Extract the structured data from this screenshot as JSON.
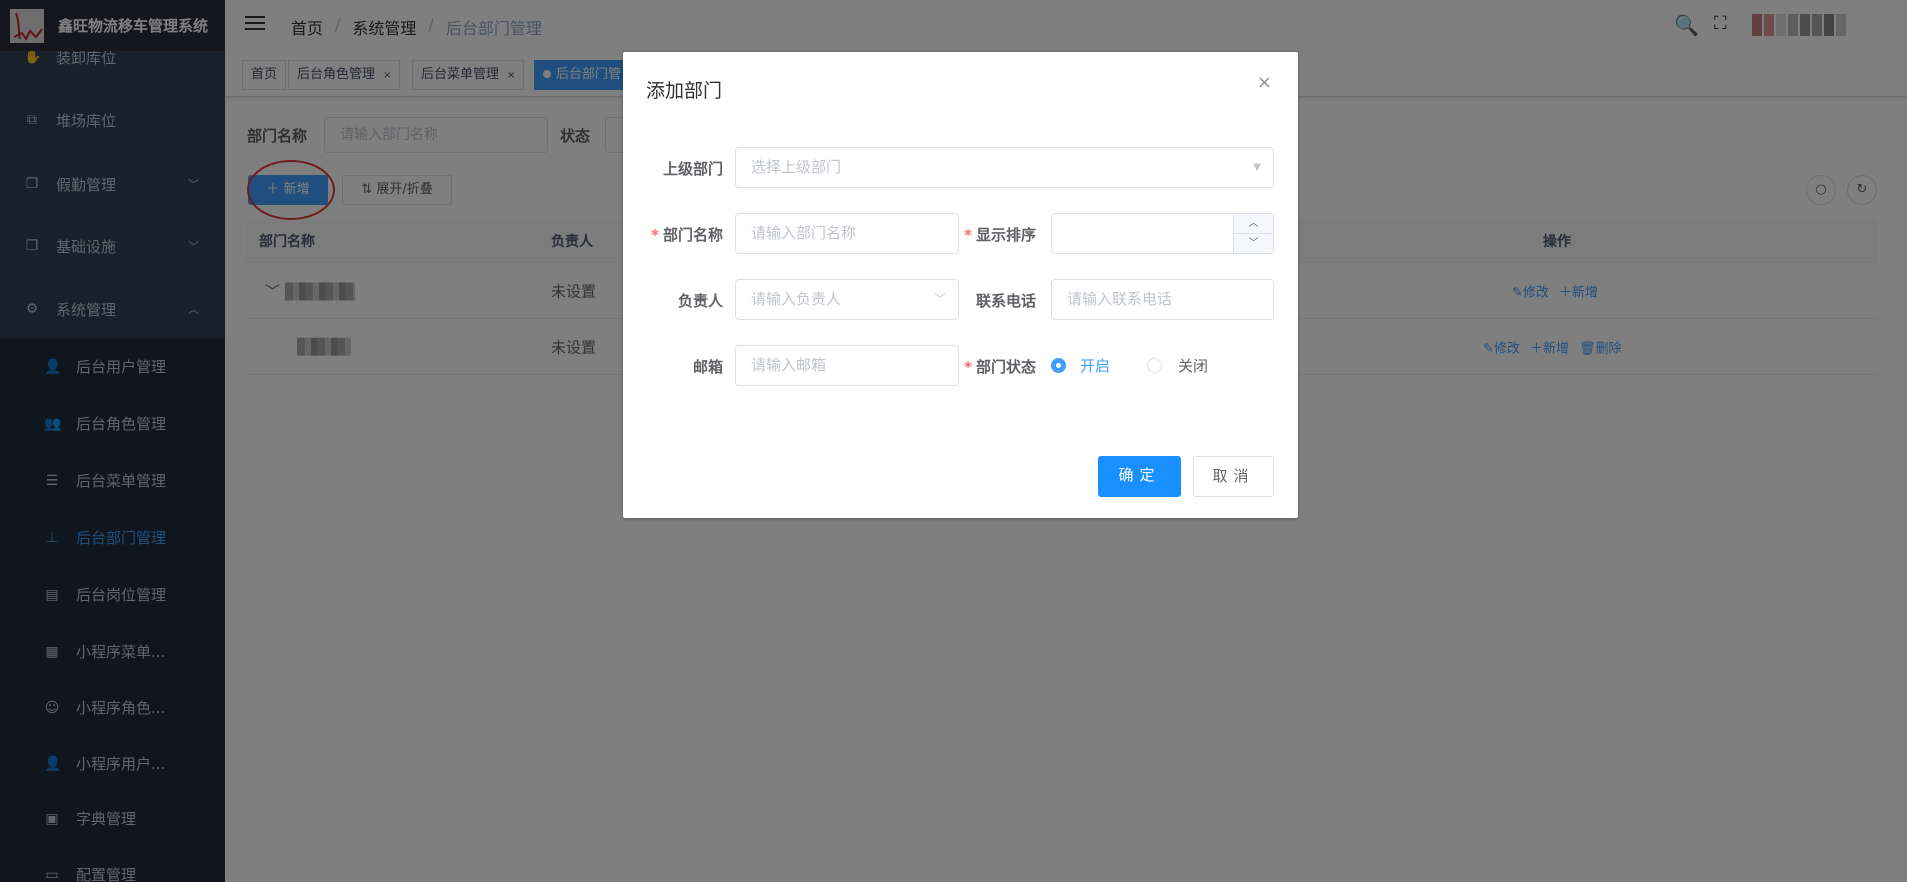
{
  "app": {
    "title": "鑫旺物流移车管理系统"
  },
  "sidebar": {
    "items": [
      {
        "label": "装卸库位",
        "icon": "hand-icon"
      },
      {
        "label": "堆场库位",
        "icon": "puzzle-icon"
      },
      {
        "label": "假勤管理",
        "icon": "copy-icon"
      },
      {
        "label": "基础设施",
        "icon": "copy-icon"
      },
      {
        "label": "系统管理",
        "icon": "gear-icon"
      }
    ],
    "sub_items": [
      {
        "label": "后台用户管理",
        "icon": "user-icon"
      },
      {
        "label": "后台角色管理",
        "icon": "peoples-icon"
      },
      {
        "label": "后台菜单管理",
        "icon": "list-icon"
      },
      {
        "label": "后台部门管理",
        "icon": "tree-icon",
        "active": true
      },
      {
        "label": "后台岗位管理",
        "icon": "post-icon"
      },
      {
        "label": "小程序菜单...",
        "icon": "table-icon"
      },
      {
        "label": "小程序角色...",
        "icon": "role-icon"
      },
      {
        "label": "小程序用户...",
        "icon": "user-icon"
      },
      {
        "label": "字典管理",
        "icon": "dict-icon"
      },
      {
        "label": "配置管理",
        "icon": "edit-icon"
      }
    ]
  },
  "header": {
    "breadcrumb": [
      "首页",
      "系统管理",
      "后台部门管理"
    ],
    "sep": "/"
  },
  "tags": [
    {
      "label": "首页"
    },
    {
      "label": "后台角色管理",
      "close": "×"
    },
    {
      "label": "后台菜单管理",
      "close": "×"
    },
    {
      "label": "后台部门管"
    }
  ],
  "search": {
    "name_label": "部门名称",
    "name_placeholder": "请输入部门名称",
    "status_label": "状态"
  },
  "toolbar": {
    "add": "新增",
    "expand": "展开/折叠"
  },
  "table": {
    "columns": [
      "部门名称",
      "负责人",
      "操作"
    ],
    "rows": [
      {
        "leader": "未设置",
        "actions": [
          "修改",
          "新增"
        ]
      },
      {
        "leader": "未设置",
        "actions": [
          "修改",
          "新增",
          "删除"
        ]
      }
    ]
  },
  "dialog": {
    "title": "添加部门",
    "close": "×",
    "parent_label": "上级部门",
    "parent_placeholder": "选择上级部门",
    "name_label": "部门名称",
    "name_placeholder": "请输入部门名称",
    "order_label": "显示排序",
    "leader_label": "负责人",
    "leader_placeholder": "请输入负责人",
    "phone_label": "联系电话",
    "phone_placeholder": "请输入联系电话",
    "email_label": "邮箱",
    "email_placeholder": "请输入邮箱",
    "status_label": "部门状态",
    "status_options": [
      "开启",
      "关闭"
    ],
    "status_selected": "开启",
    "required_mark": "*",
    "confirm": "确定",
    "cancel": "取消"
  },
  "colors": {
    "primary": "#409eff",
    "sidebar": "#304156",
    "danger": "#f56c6c"
  }
}
